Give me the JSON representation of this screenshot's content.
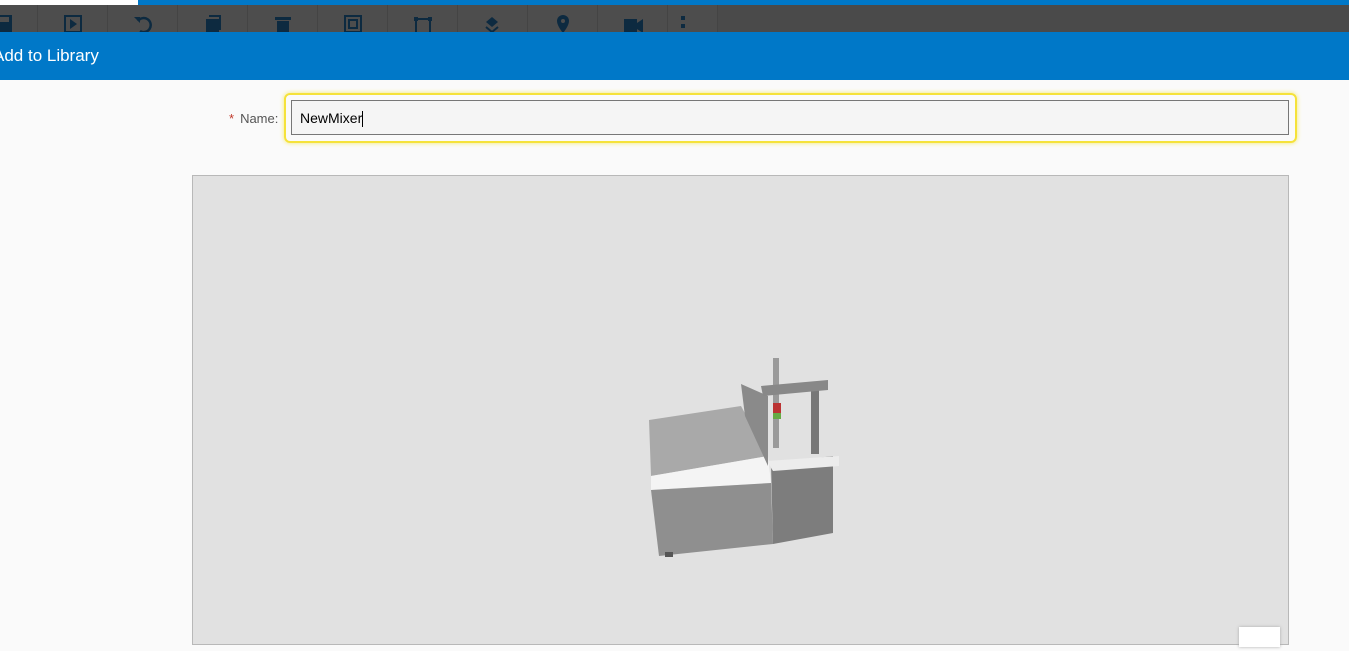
{
  "toolbar": {
    "items": [
      {
        "icon": "save-icon"
      },
      {
        "icon": "play-icon"
      },
      {
        "icon": "undo-icon"
      },
      {
        "icon": "copy-icon"
      },
      {
        "icon": "delete-icon"
      },
      {
        "icon": "group-icon"
      },
      {
        "icon": "ungroup-icon"
      },
      {
        "icon": "layers-icon"
      },
      {
        "icon": "location-pin-icon"
      },
      {
        "icon": "camera-reset-icon"
      },
      {
        "icon": "more-vertical-icon"
      }
    ]
  },
  "header": {
    "title": "Add to Library"
  },
  "form": {
    "name_label": "Name:",
    "required_marker": "*",
    "name_value": "NewMixer"
  },
  "colors": {
    "accent": "#0078c8",
    "toolbar": "#4d4d4d",
    "focus": "#f5e23a"
  }
}
